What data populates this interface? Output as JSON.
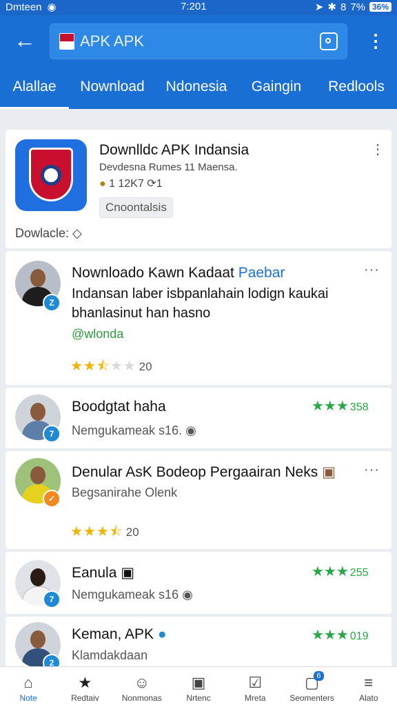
{
  "status": {
    "carrier": "Dmteen",
    "time": "7:201",
    "battery_text": "36%",
    "percent_text": "7%"
  },
  "search": {
    "query": "APK APK"
  },
  "tabs": [
    {
      "label": "Alallae",
      "active": true
    },
    {
      "label": "Nownload",
      "active": false
    },
    {
      "label": "Ndonesia",
      "active": false
    },
    {
      "label": "Gaingin",
      "active": false
    },
    {
      "label": "Redlools",
      "active": false
    }
  ],
  "app_card": {
    "title": "Downlldc APK Indansia",
    "subtitle": "Devdesna Rumes 11 Maensa.",
    "stat_downloads": "1 12K7",
    "stat_other": "1",
    "chip": "Cnoontalsis",
    "footer": "Dowlacle:"
  },
  "reviews": [
    {
      "name": "Nownloado Kawn Kadaat",
      "tag": "Paebar",
      "body_line1": "Indansan laber isbpanlahain lodign kaukai",
      "body_line2": "bhanlasinut han hasno",
      "handle": "@wlonda",
      "rating": 2.5,
      "count": "20",
      "badge": "Z"
    },
    {
      "name": "Boodgtat haha",
      "sub": "Nemgukameak s16.",
      "green_rating": "358",
      "badge": "7"
    },
    {
      "name": "Denular AsK Bodeop Pergaairan Neks",
      "sub": "Begsanirahe Olenk",
      "rating": 3.5,
      "count": "20",
      "badge": "✓"
    },
    {
      "name": "Eanula",
      "sub": "Nemgukameak s16",
      "green_rating": "255",
      "badge": "7"
    },
    {
      "name": "Keman, APK",
      "sub": "Klamdakdaan",
      "green_rating": "019",
      "badge": "2"
    }
  ],
  "bottom_nav": [
    {
      "label": "Note",
      "icon": "home-icon",
      "active": true
    },
    {
      "label": "Redtaiv",
      "icon": "star-icon",
      "active": false
    },
    {
      "label": "Nonmonas",
      "icon": "smile-icon",
      "active": false
    },
    {
      "label": "Nrtenc",
      "icon": "box-icon",
      "active": false
    },
    {
      "label": "Mreta",
      "icon": "check-bag-icon",
      "active": false
    },
    {
      "label": "Seomenters",
      "icon": "chat-icon",
      "active": false,
      "count": "6"
    },
    {
      "label": "Alato",
      "icon": "menu-icon",
      "active": false
    }
  ],
  "colors": {
    "primary": "#1a6fd4",
    "star": "#f0b400",
    "green_star": "#27a845"
  }
}
